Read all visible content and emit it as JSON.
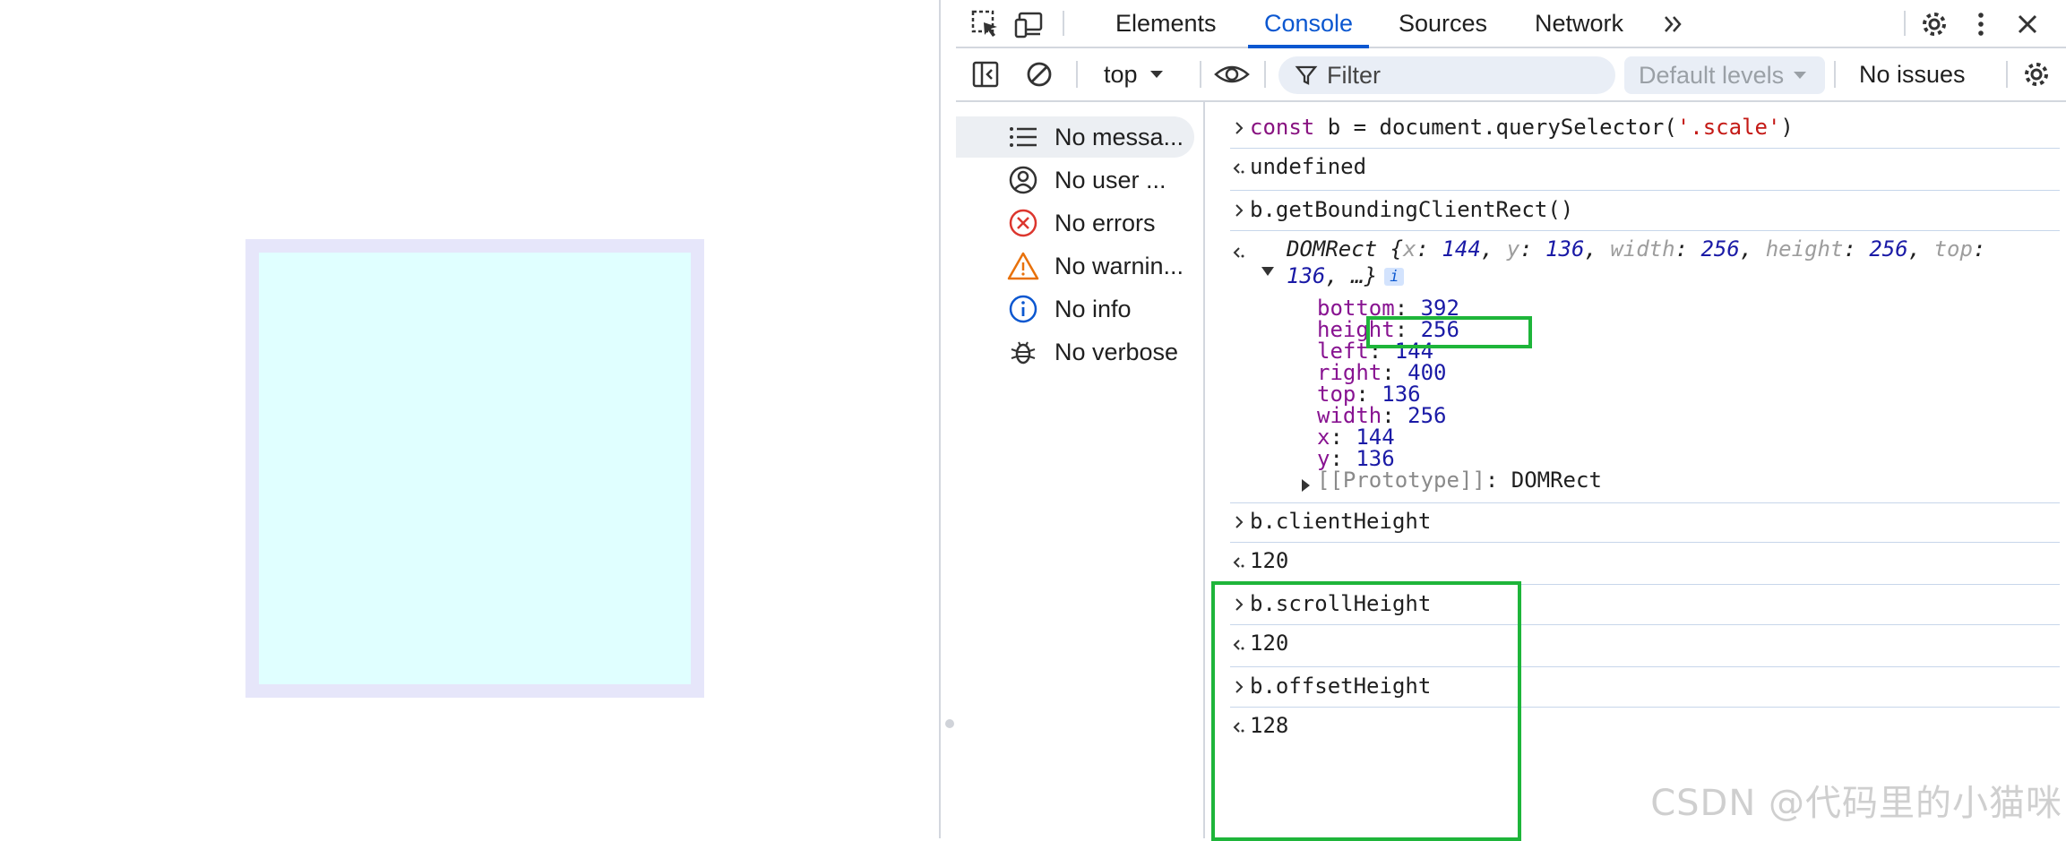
{
  "tabs": [
    "Elements",
    "Console",
    "Sources",
    "Network"
  ],
  "active_tab": "Console",
  "toolbar": {
    "context": "top",
    "filter_placeholder": "Filter",
    "levels_label": "Default levels",
    "issues_label": "No issues"
  },
  "sidebar": {
    "items": [
      {
        "label": "No messa...",
        "icon": "list-icon",
        "selected": true
      },
      {
        "label": "No user ...",
        "icon": "user-icon",
        "selected": false
      },
      {
        "label": "No errors",
        "icon": "error-icon",
        "selected": false
      },
      {
        "label": "No warnin...",
        "icon": "warning-icon",
        "selected": false
      },
      {
        "label": "No info",
        "icon": "info-icon",
        "selected": false
      },
      {
        "label": "No verbose",
        "icon": "bug-icon",
        "selected": false
      }
    ]
  },
  "console": {
    "cmd1": {
      "kw": "const",
      "mid": " b = document.querySelector(",
      "str": "'.scale'",
      "end": ")"
    },
    "res1": "undefined",
    "cmd2": "b.getBoundingClientRect()",
    "domrect": {
      "name": "DOMRect",
      "preview_line1_open": " {",
      "preview": [
        {
          "k": "x",
          "v": "144"
        },
        {
          "k": "y",
          "v": "136"
        },
        {
          "k": "width",
          "v": "256"
        },
        {
          "k": "height",
          "v": "256"
        },
        {
          "k": "top",
          "v": ""
        }
      ],
      "preview_line2_val": "136",
      "preview_line2_rest": ", …}",
      "info_badge": "i",
      "props": [
        {
          "k": "bottom",
          "v": "392"
        },
        {
          "k": "height",
          "v": "256"
        },
        {
          "k": "left",
          "v": "144"
        },
        {
          "k": "right",
          "v": "400"
        },
        {
          "k": "top",
          "v": "136"
        },
        {
          "k": "width",
          "v": "256"
        },
        {
          "k": "x",
          "v": "144"
        },
        {
          "k": "y",
          "v": "136"
        }
      ],
      "prototype_key": "[[Prototype]]",
      "prototype_val": "DOMRect"
    },
    "cmd3": "b.clientHeight",
    "res3": "120",
    "cmd4": "b.scrollHeight",
    "res4": "120",
    "cmd5": "b.offsetHeight",
    "res5": "128"
  },
  "watermark": "CSDN @代码里的小猫咪",
  "colors": {
    "box_outer": "#e6e6fa",
    "box_inner": "#e0ffff",
    "highlight": "#1eb53a",
    "accent": "#0b57d0"
  }
}
